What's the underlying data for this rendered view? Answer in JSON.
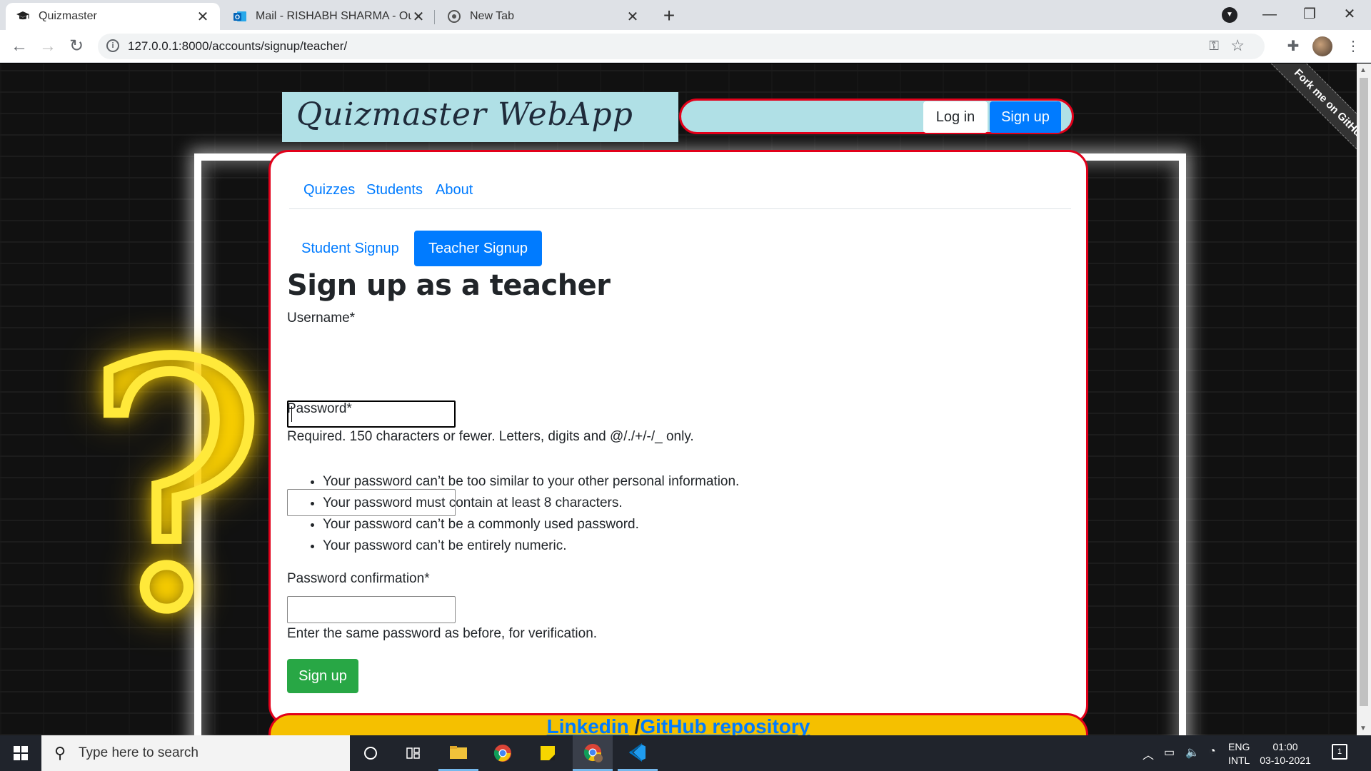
{
  "browser": {
    "tabs": [
      {
        "title": "Quizmaster",
        "active": true,
        "icon": "graduation-cap-icon"
      },
      {
        "title": "Mail - RISHABH SHARMA - Outlo",
        "active": false,
        "icon": "outlook-icon"
      },
      {
        "title": "New Tab",
        "active": false,
        "icon": "chrome-icon"
      }
    ],
    "url": "127.0.0.1:8000/accounts/signup/teacher/"
  },
  "site": {
    "brand": "Quizmaster WebApp",
    "login_label": "Log in",
    "signup_label": "Sign up",
    "fork_ribbon": "Fork me on GitHub",
    "nav": [
      "Quizzes",
      "Students",
      "About"
    ],
    "pills": {
      "student": "Student Signup",
      "teacher": "Teacher Signup",
      "active": "teacher"
    }
  },
  "form": {
    "title": "Sign up as a teacher",
    "username_label": "Username*",
    "username_value": "",
    "username_help": "Required. 150 characters or fewer. Letters, digits and @/./+/-/_ only.",
    "password_label": "Password*",
    "password_rules": [
      "Your password can’t be too similar to your other personal information.",
      "Your password must contain at least 8 characters.",
      "Your password can’t be a commonly used password.",
      "Your password can’t be entirely numeric."
    ],
    "confirm_label": "Password confirmation*",
    "confirm_help": "Enter the same password as before, for verification.",
    "submit_label": "Sign up"
  },
  "footer": {
    "linkedin": "Linkedin",
    "separator": " /",
    "github": "GitHub repository"
  },
  "taskbar": {
    "search_placeholder": "Type here to search",
    "lang_line1": "ENG",
    "lang_line2": "INTL",
    "time": "01:00",
    "date": "03-10-2021",
    "notifications": "1"
  },
  "colors": {
    "accent": "#007bff",
    "success": "#28a745",
    "brand_bg": "#b0e0e6",
    "border_red": "#e2001a",
    "footer_bg": "#f5c000"
  }
}
